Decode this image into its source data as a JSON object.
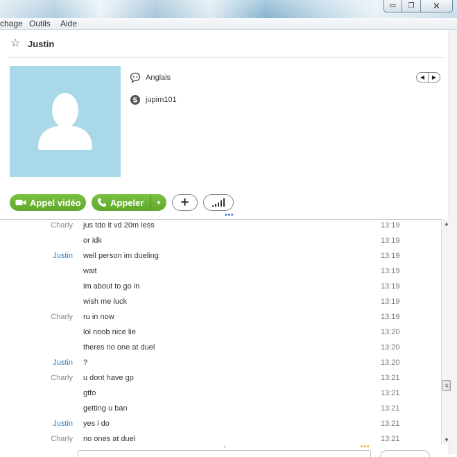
{
  "menu": {
    "items": [
      "chage",
      "Outils",
      "Aide"
    ]
  },
  "contact": {
    "name": "Justin",
    "language": "Anglais",
    "skype_id": "jupim101"
  },
  "actions": {
    "video_label": "Appel vidéo",
    "call_label": "Appeler"
  },
  "icons": {
    "star": "star-icon",
    "language": "speech-bubble-icon",
    "skype": "skype-icon",
    "video": "video-camera-icon",
    "phone": "phone-icon",
    "plus": "plus-icon",
    "signal": "signal-bars-icon"
  },
  "colors": {
    "green_button": "#6cb535",
    "justin_name": "#2a7bc0",
    "charly_name": "#888888",
    "avatar_bg": "#a9d8e8"
  },
  "messages": [
    {
      "sender": "Charly",
      "text": "jus tdo it vd 20m less",
      "time": "13:19"
    },
    {
      "sender": "",
      "text": "or idk",
      "time": "13:19"
    },
    {
      "sender": "Justin",
      "text": "well person im dueling",
      "time": "13:19"
    },
    {
      "sender": "",
      "text": "wait",
      "time": "13:19"
    },
    {
      "sender": "",
      "text": "im about to go in",
      "time": "13:19"
    },
    {
      "sender": "",
      "text": "wish me luck",
      "time": "13:19"
    },
    {
      "sender": "Charly",
      "text": "ru in now",
      "time": "13:19"
    },
    {
      "sender": "",
      "text": "lol noob nice lie",
      "time": "13:20"
    },
    {
      "sender": "",
      "text": "theres no one at duel",
      "time": "13:20"
    },
    {
      "sender": "Justin",
      "text": "?",
      "time": "13:20"
    },
    {
      "sender": "Charly",
      "text": "u dont have gp",
      "time": "13:21"
    },
    {
      "sender": "",
      "text": "gtfo",
      "time": "13:21"
    },
    {
      "sender": "",
      "text": "getting u ban",
      "time": "13:21"
    },
    {
      "sender": "Justin",
      "text": "yes i do",
      "time": "13:21"
    },
    {
      "sender": "Charly",
      "text": "no ones at duel",
      "time": "13:21"
    }
  ]
}
